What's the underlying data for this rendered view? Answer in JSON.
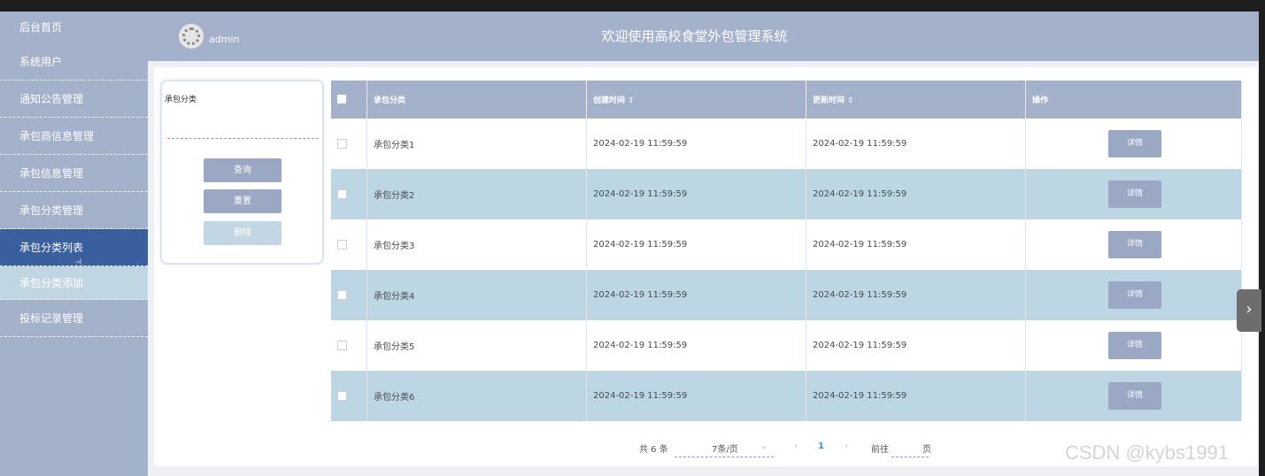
{
  "sidebar": {
    "items": [
      {
        "label": "后台首页"
      },
      {
        "label": "系统用户"
      },
      {
        "label": "通知公告管理"
      },
      {
        "label": "承包商信息管理"
      },
      {
        "label": "承包信息管理"
      },
      {
        "label": "承包分类管理"
      },
      {
        "label": "承包分类列表"
      },
      {
        "label": "承包分类添加"
      },
      {
        "label": "投标记录管理"
      }
    ]
  },
  "header": {
    "username": "admin",
    "title": "欢迎使用高校食堂外包管理系统"
  },
  "search": {
    "label": "承包分类",
    "placeholder": "",
    "query_label": "查询",
    "reset_label": "重置",
    "delete_label": "删除"
  },
  "table": {
    "headers": [
      "承包分类",
      "创建时间",
      "更新时间",
      "操作"
    ],
    "sort_icon": "⇕",
    "detail_label": "详情",
    "rows": [
      {
        "category": "承包分类1",
        "created": "2024-02-19 11:59:59",
        "updated": "2024-02-19 11:59:59"
      },
      {
        "category": "承包分类2",
        "created": "2024-02-19 11:59:59",
        "updated": "2024-02-19 11:59:59"
      },
      {
        "category": "承包分类3",
        "created": "2024-02-19 11:59:59",
        "updated": "2024-02-19 11:59:59"
      },
      {
        "category": "承包分类4",
        "created": "2024-02-19 11:59:59",
        "updated": "2024-02-19 11:59:59"
      },
      {
        "category": "承包分类5",
        "created": "2024-02-19 11:59:59",
        "updated": "2024-02-19 11:59:59"
      },
      {
        "category": "承包分类6",
        "created": "2024-02-19 11:59:59",
        "updated": "2024-02-19 11:59:59"
      }
    ]
  },
  "pagination": {
    "total": "共 6 条",
    "page_size": "7条/页",
    "current_page": "1",
    "goto_label": "前往",
    "page_label": "页"
  },
  "watermark": "CSDN @kybs1991",
  "colors": {
    "sidebar": "#a3b1cb",
    "sidebar_active": "#3a5f9e",
    "row_alt": "#bdd6e4",
    "button": "#9aa8c4"
  }
}
